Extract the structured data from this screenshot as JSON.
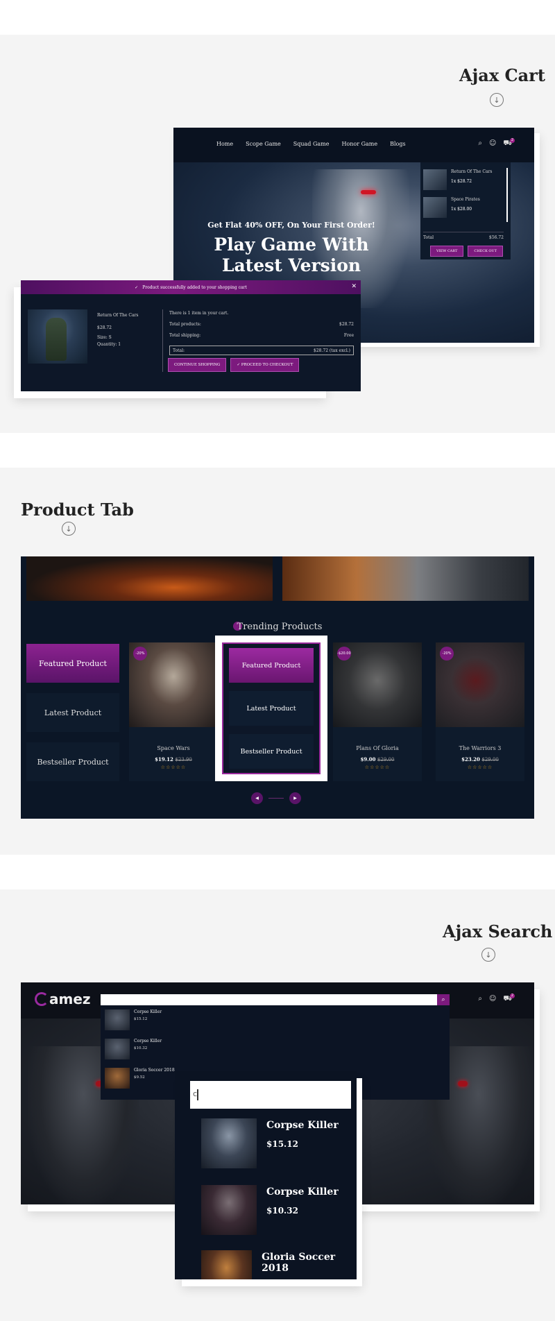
{
  "colors": {
    "accent": "#7c1a7e",
    "dark_bg": "#0b1626",
    "page_bg": "#f4f4f4"
  },
  "ajax_cart": {
    "section_title": "Ajax Cart",
    "nav_links": [
      "Home",
      "Scope Game",
      "Squad Game",
      "Honor Game",
      "Blogs"
    ],
    "cart_count": "2",
    "hero_line1": "Get Flat 40% OFF, On Your First Order!",
    "hero_line2": "Play Game With",
    "hero_line3": "Latest Version",
    "dropdown": {
      "items": [
        {
          "name": "Return Of The Cars",
          "price": "1x $28.72"
        },
        {
          "name": "Space Pirates",
          "price": "1x $28.00"
        }
      ],
      "total_label": "Total",
      "total_value": "$56.72",
      "view_cart": "VIEW CART",
      "check_out": "CHECK OUT"
    },
    "modal": {
      "header": "Product successfully added to your shopping cart",
      "product_name": "Return Of The Cars",
      "product_price": "$28.72",
      "size": "Size: S",
      "quantity": "Quantity: 1",
      "items_in_cart": "There is 1 item in your cart.",
      "total_products_label": "Total products:",
      "total_products_value": "$28.72",
      "total_shipping_label": "Total shipping:",
      "total_shipping_value": "Free",
      "total_label": "Total:",
      "total_value": "$28.72 (tax excl.)",
      "continue_btn": "CONTINUE SHOPPING",
      "checkout_btn": "PROCEED TO CHECKOUT"
    }
  },
  "product_tab": {
    "section_title": "Product Tab",
    "title": "Trending Products",
    "tabs": [
      "Featured Product",
      "Latest Product",
      "Bestseller Product"
    ],
    "products": [
      {
        "badge": "-20%",
        "name": "Space Wars",
        "price": "$19.12",
        "old_price": "$23.90"
      },
      {
        "badge": "-$20.00",
        "name": "Plans Of Gloria",
        "price": "$9.00",
        "old_price": "$29.00"
      },
      {
        "badge": "-20%",
        "name": "The Warriors 3",
        "price": "$23.20",
        "old_price": "$29.00"
      }
    ],
    "stars": "☆☆☆☆☆"
  },
  "ajax_search": {
    "section_title": "Ajax Search",
    "logo_text": "amez",
    "query": "c",
    "results": [
      {
        "name": "Corpse Killer",
        "price": "$15.12"
      },
      {
        "name": "Corpse Killer",
        "price": "$10.32"
      },
      {
        "name": "Gloria Soccer 2018",
        "price": "$9.52"
      }
    ]
  }
}
